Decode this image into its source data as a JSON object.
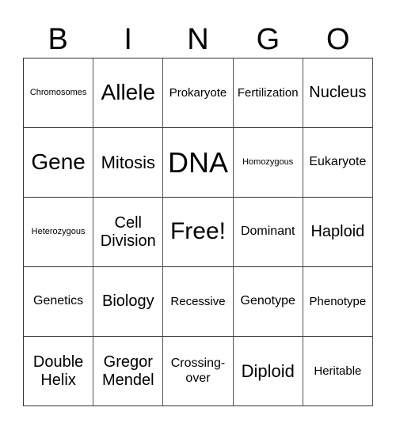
{
  "header": {
    "letters": [
      "B",
      "I",
      "N",
      "G",
      "O"
    ]
  },
  "cells": [
    [
      "Chromosomes",
      "Allele",
      "Prokaryote",
      "Fertilization",
      "Nucleus"
    ],
    [
      "Gene",
      "Mitosis",
      "DNA",
      "Homozygous",
      "Eukaryote"
    ],
    [
      "Heterozygous",
      "Cell\nDivision",
      "Free!",
      "Dominant",
      "Haploid"
    ],
    [
      "Genetics",
      "Biology",
      "Recessive",
      "Genotype",
      "Phenotype"
    ],
    [
      "Double\nHelix",
      "Gregor\nMendel",
      "Crossing-\nover",
      "Diploid",
      "Heritable"
    ]
  ]
}
